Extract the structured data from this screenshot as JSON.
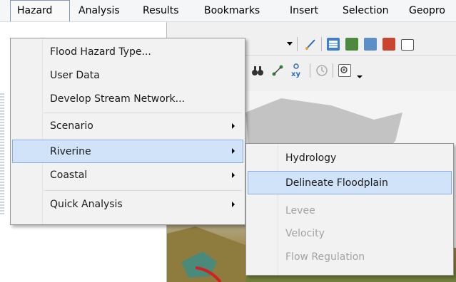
{
  "menubar": {
    "items": [
      "Hazard",
      "Analysis",
      "Results",
      "Bookmarks",
      "Insert",
      "Selection",
      "Geopro"
    ],
    "active_index": 0
  },
  "hazard_menu": {
    "items": [
      {
        "label": "Flood Hazard Type...",
        "submenu": false
      },
      {
        "label": "User Data",
        "submenu": false
      },
      {
        "label": "Develop Stream Network...",
        "submenu": false
      },
      {
        "label": "Scenario",
        "submenu": true
      },
      {
        "label": "Riverine",
        "submenu": true,
        "selected": true
      },
      {
        "label": "Coastal",
        "submenu": true
      },
      {
        "label": "Quick Analysis",
        "submenu": true
      }
    ]
  },
  "riverine_submenu": {
    "items": [
      {
        "label": "Hydrology",
        "enabled": true
      },
      {
        "label": "Delineate Floodplain",
        "enabled": true,
        "highlighted": true
      },
      {
        "label": "Levee",
        "enabled": false
      },
      {
        "label": "Velocity",
        "enabled": false
      },
      {
        "label": "Flow Regulation",
        "enabled": false
      }
    ]
  },
  "toolbar_icons": [
    "edit-vertex-icon",
    "attribute-table-icon",
    "layer-icon",
    "catalog-icon",
    "toolbox-icon",
    "window-icon",
    "binoculars-icon",
    "route-icon",
    "xy-icon",
    "time-slider-icon",
    "zoom-window-icon"
  ],
  "colors": {
    "menu_background": "#f2f2f2",
    "selected_fill": "#d1e3f8",
    "selected_border": "#84ace6",
    "disabled_text": "#a3a3a3"
  }
}
